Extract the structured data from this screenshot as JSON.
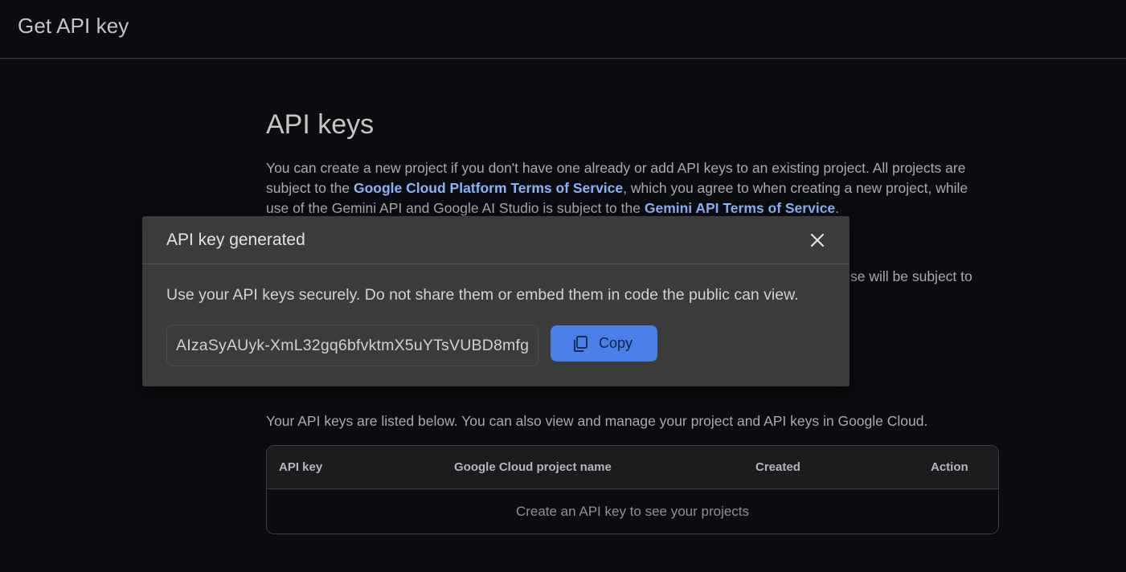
{
  "header": {
    "title": "Get API key"
  },
  "main": {
    "heading": "API keys",
    "intro_part1": "You can create a new project if you don't have one already or add API keys to an existing project. All projects are subject to the ",
    "gcp_tos_link": "Google Cloud Platform Terms of Service",
    "intro_part2": ", which you agree to when creating a new project, while use of the Gemini API and Google AI Studio is subject to the ",
    "gemini_tos_link": "Gemini API Terms of Service",
    "intro_part3": ".",
    "partial_line": "se will be subject to",
    "keys_description": "Your API keys are listed below. You can also view and manage your project and API keys in Google Cloud."
  },
  "table": {
    "columns": [
      "API key",
      "Google Cloud project name",
      "Created",
      "Action"
    ],
    "empty_message": "Create an API key to see your projects"
  },
  "dialog": {
    "title": "API key generated",
    "warning": "Use your API keys securely. Do not share them or embed them in code the public can view.",
    "api_key": "AIzaSyAUyk-XmL32gq6bfvktmX5uYTsVUBD8mfg",
    "copy_label": "Copy",
    "close_icon": "close-icon",
    "copy_icon": "copy-icon"
  },
  "colors": {
    "background": "#0b0c0f",
    "link": "#8ab4f8",
    "dialog_bg": "#3b3b3c",
    "primary_button": "#4a7fe8"
  }
}
